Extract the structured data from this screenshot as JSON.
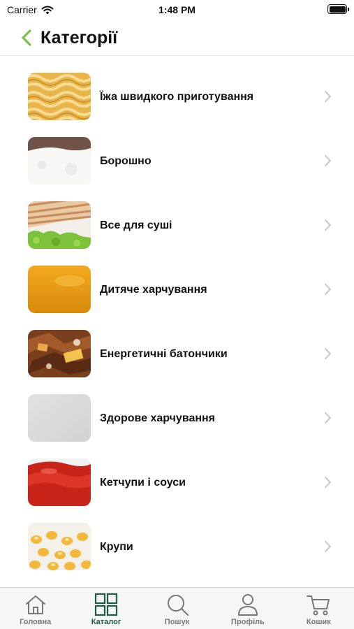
{
  "status_bar": {
    "carrier": "Carrier",
    "time": "1:48 PM",
    "icons": [
      "wifi-icon",
      "battery-icon"
    ]
  },
  "header": {
    "title": "Категорії",
    "back_icon": "chevron-left-icon",
    "accent_color": "#7cbf4a"
  },
  "categories": [
    {
      "label": "Їжа швидкого приготування",
      "image": "noodles-image",
      "icon": "chevron-right-icon"
    },
    {
      "label": "Борошно",
      "image": "flour-image",
      "icon": "chevron-right-icon"
    },
    {
      "label": "Все для суші",
      "image": "sushi-image",
      "icon": "chevron-right-icon"
    },
    {
      "label": "Дитяче харчування",
      "image": "baby-food-image",
      "icon": "chevron-right-icon"
    },
    {
      "label": "Енергетичні батончики",
      "image": "energy-bar-image",
      "icon": "chevron-right-icon"
    },
    {
      "label": "Здорове харчування",
      "image": "healthy-food-image",
      "icon": "chevron-right-icon"
    },
    {
      "label": "Кетчупи і соуси",
      "image": "ketchup-image",
      "icon": "chevron-right-icon"
    },
    {
      "label": "Крупи",
      "image": "grains-image",
      "icon": "chevron-right-icon"
    }
  ],
  "tab_bar": {
    "active_color": "#1d5c40",
    "inactive_color": "#777777",
    "items": [
      {
        "label": "Головна",
        "icon": "home-icon",
        "active": false
      },
      {
        "label": "Каталог",
        "icon": "grid-icon",
        "active": true
      },
      {
        "label": "Пошук",
        "icon": "search-icon",
        "active": false
      },
      {
        "label": "Профіль",
        "icon": "user-icon",
        "active": false
      },
      {
        "label": "Кошик",
        "icon": "cart-icon",
        "active": false
      }
    ]
  }
}
